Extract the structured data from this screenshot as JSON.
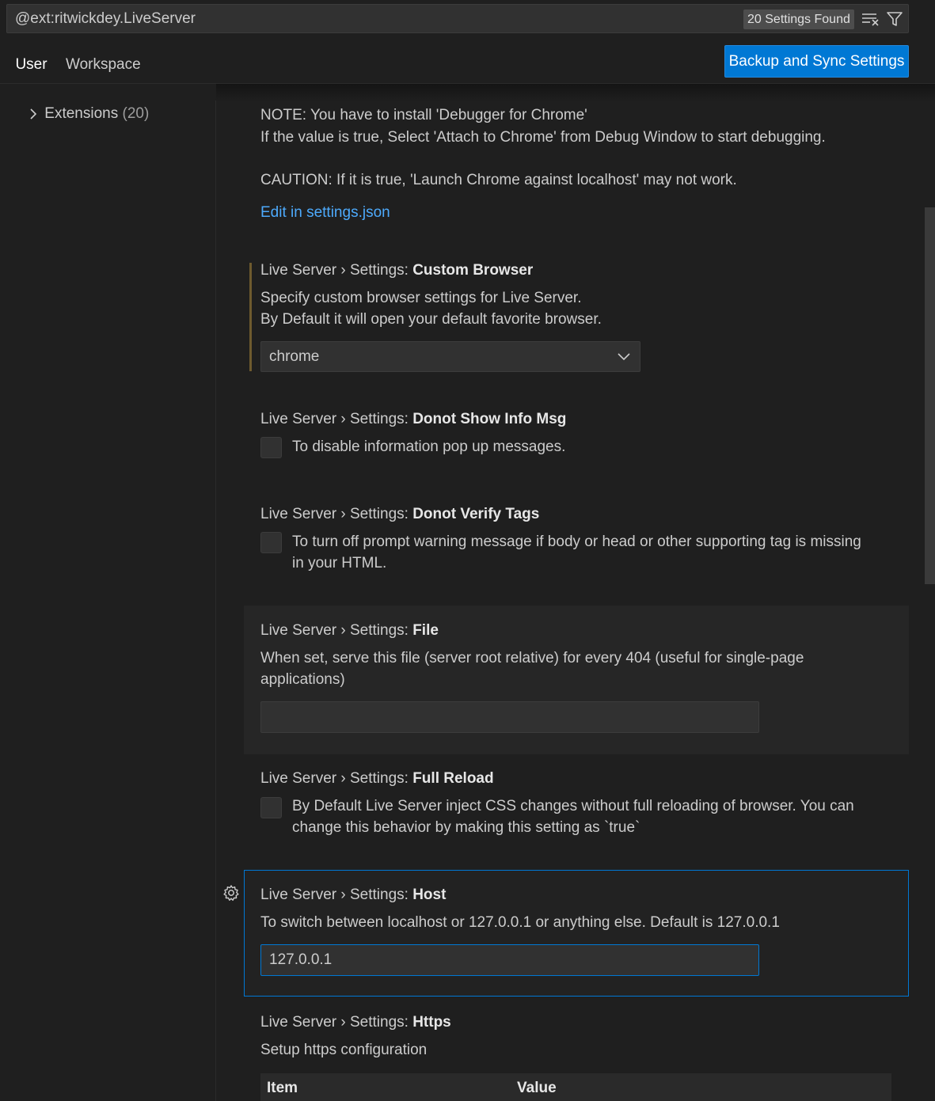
{
  "search": {
    "query": "@ext:ritwickdey.LiveServer",
    "results_badge": "20 Settings Found",
    "clear_icon": "clear-filter-icon",
    "filter_icon": "filter-icon"
  },
  "tabs": [
    {
      "label": "User",
      "active": true
    },
    {
      "label": "Workspace",
      "active": false
    }
  ],
  "sync_button_label": "Backup and Sync Settings",
  "sidebar": {
    "items": [
      {
        "label": "Extensions",
        "count": "(20)",
        "icon": "chevron-right-icon"
      }
    ]
  },
  "content": {
    "partial": {
      "line1": "NOTE: You have to install 'Debugger for Chrome'",
      "line2": "If the value is true, Select 'Attach to Chrome' from Debug Window to start debugging.",
      "caution": "CAUTION: If it is true, 'Launch Chrome against localhost' may not work.",
      "edit_link": "Edit in settings.json"
    },
    "settings": [
      {
        "category": "Live Server › Settings: ",
        "name": "Custom Browser",
        "desc1": "Specify custom browser settings for Live Server.",
        "desc2": "By Default it will open your default favorite browser.",
        "value": "chrome"
      },
      {
        "category": "Live Server › Settings: ",
        "name": "Donot Show Info Msg",
        "desc1": "To disable information pop up messages.",
        "checked": false
      },
      {
        "category": "Live Server › Settings: ",
        "name": "Donot Verify Tags",
        "desc1": "To turn off prompt warning message if body or head or other supporting tag is missing",
        "desc2": "in your HTML.",
        "checked": false
      },
      {
        "category": "Live Server › Settings: ",
        "name": "File",
        "desc1": "When set, serve this file (server root relative) for every 404 (useful for single-page",
        "desc2": "applications)",
        "value": ""
      },
      {
        "category": "Live Server › Settings: ",
        "name": "Full Reload",
        "desc1": "By Default Live Server inject CSS changes without full reloading of browser. You can",
        "desc2": "change this behavior by making this setting as `true`",
        "checked": false
      },
      {
        "category": "Live Server › Settings: ",
        "name": "Host",
        "desc1": "To switch between localhost or 127.0.0.1 or anything else. Default is 127.0.0.1",
        "value": "127.0.0.1",
        "gear_icon": "gear-icon"
      },
      {
        "category": "Live Server › Settings: ",
        "name": "Https",
        "desc1": "Setup https configuration",
        "table_headers": [
          "Item",
          "Value"
        ]
      }
    ]
  },
  "colors": {
    "background": "#1f1f1f",
    "accent": "#0078d4",
    "link": "#4daafc",
    "modified_indicator": "#6e5a2e"
  }
}
